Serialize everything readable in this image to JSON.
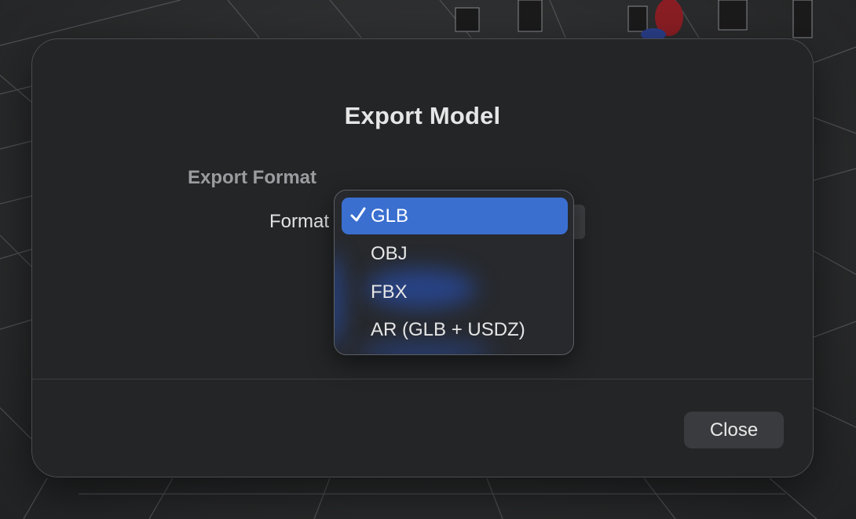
{
  "dialog": {
    "title": "Export Model",
    "section_heading": "Export Format",
    "format_label": "Format",
    "close_label": "Close"
  },
  "format_menu": {
    "selected": "GLB",
    "options": [
      "GLB",
      "OBJ",
      "FBX",
      "AR (GLB + USDZ)"
    ]
  },
  "colors": {
    "selection": "#3a6fd0",
    "dialog_background": "#232527"
  },
  "icons": {
    "selected_marker": "checkmark-icon"
  }
}
